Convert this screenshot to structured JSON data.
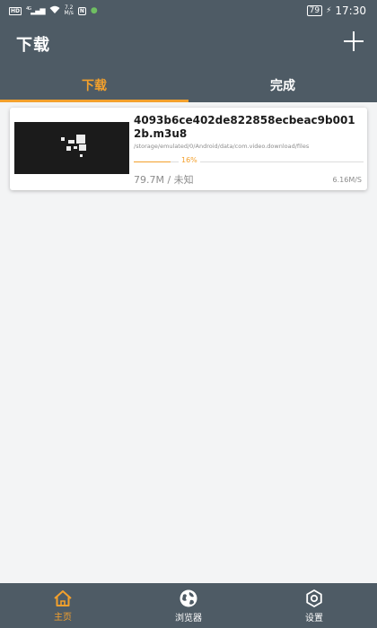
{
  "status_bar": {
    "hd_label": "HD",
    "network_label": "4G",
    "speed_value": "7.2",
    "speed_unit": "M/s",
    "battery": "79",
    "time": "17:30"
  },
  "header": {
    "title": "下载",
    "add_icon": "plus-icon"
  },
  "tabs": [
    {
      "label": "下载",
      "active": true
    },
    {
      "label": "完成",
      "active": false
    }
  ],
  "downloads": [
    {
      "file_name": "4093b6ce402de822858ecbeac9b0012b.m3u8",
      "path": "/storage/emulated/0/Android/data/com.video.download/files",
      "progress_label": "16%",
      "progress": 0.16,
      "size": "79.7M / 未知",
      "speed": "6.16M/S"
    }
  ],
  "bottom_nav": [
    {
      "label": "主页",
      "icon": "home-icon",
      "active": true
    },
    {
      "label": "浏览器",
      "icon": "globe-icon",
      "active": false
    },
    {
      "label": "设置",
      "icon": "gear-icon",
      "active": false
    }
  ],
  "colors": {
    "bar_bg": "#4e5b65",
    "accent": "#f3a02c",
    "page_bg": "#f3f4f5"
  }
}
